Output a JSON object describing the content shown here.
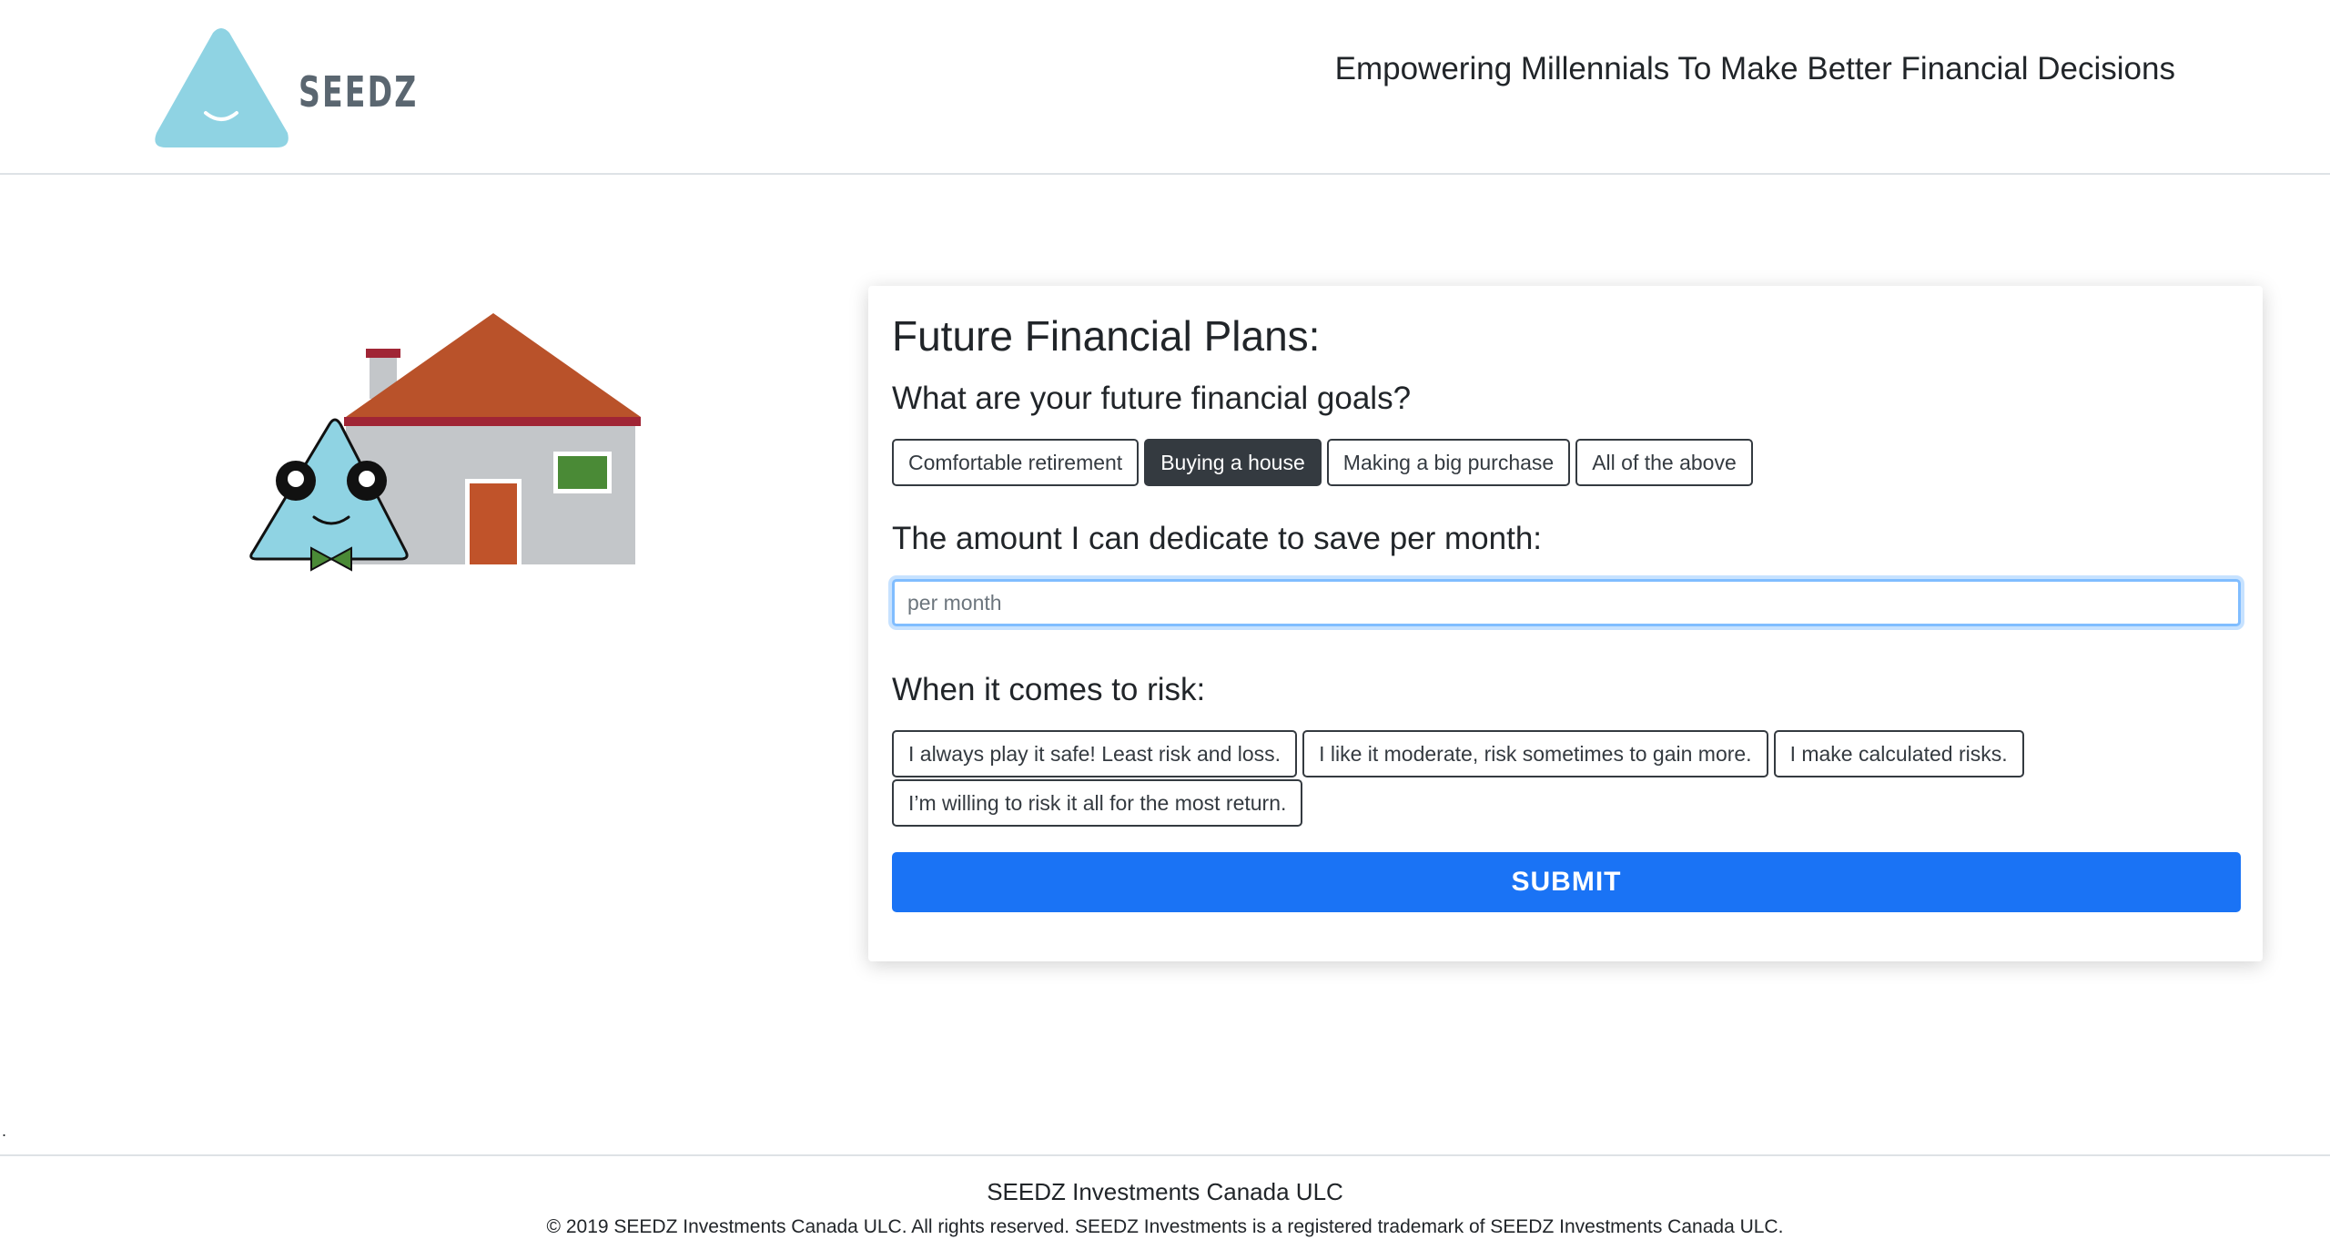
{
  "header": {
    "logo_text": "SEEDZ",
    "tagline": "Empowering Millennials To Make Better Financial Decisions"
  },
  "form": {
    "title": "Future Financial Plans:",
    "goals_question": "What are your future financial goals?",
    "goals": [
      {
        "label": "Comfortable retirement",
        "selected": false
      },
      {
        "label": "Buying a house",
        "selected": true
      },
      {
        "label": "Making a big purchase",
        "selected": false
      },
      {
        "label": "All of the above",
        "selected": false
      }
    ],
    "amount_question": "The amount I can dedicate to save per month:",
    "amount_placeholder": "per month",
    "amount_value": "",
    "risk_question": "When it comes to risk:",
    "risk_options": [
      {
        "label": "I always play it safe! Least risk and loss.",
        "selected": false
      },
      {
        "label": "I like it moderate, risk sometimes to gain more.",
        "selected": false
      },
      {
        "label": "I make calculated risks.",
        "selected": false
      },
      {
        "label": "I’m willing to risk it all for the most return.",
        "selected": false
      }
    ],
    "submit_label": "SUBMIT"
  },
  "page": {
    "stray_text": "."
  },
  "footer": {
    "company": "SEEDZ Investments Canada ULC",
    "copyright": "© 2019 SEEDZ Investments Canada ULC. All rights reserved. SEEDZ Investments is a registered trademark of SEEDZ Investments Canada ULC."
  },
  "colors": {
    "brand_blue": "#8fd3e3",
    "submit_blue": "#1a73f5",
    "dark_button": "#343a40",
    "roof": "#b9522a",
    "roof_trim": "#a02535",
    "wall": "#c3c6c9",
    "door": "#c0532a",
    "window": "#4a8a36"
  }
}
